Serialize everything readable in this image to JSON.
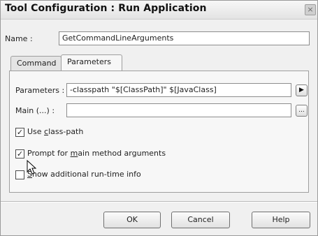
{
  "window": {
    "title": "Tool Configuration : Run Application",
    "close_glyph": "×"
  },
  "name_field": {
    "label": "Name :",
    "value": "GetCommandLineArguments"
  },
  "tabs": [
    {
      "label": "Command",
      "active": false
    },
    {
      "label": "Parameters",
      "active": true
    }
  ],
  "parameters_panel": {
    "parameters_label": "Parameters :",
    "parameters_value": "-classpath \"$[ClassPath]\" $[JavaClass]",
    "parameters_button_glyph": "▶",
    "main_label": "Main (...) :",
    "main_value": "",
    "main_button_glyph": "...",
    "checkboxes": [
      {
        "pre": "Use ",
        "mnemonic": "c",
        "post": "lass-path",
        "checked": true
      },
      {
        "pre": "Prompt for ",
        "mnemonic": "m",
        "post": "ain method arguments",
        "checked": true
      },
      {
        "pre": "",
        "mnemonic": "S",
        "post": "how additional run-time info",
        "checked": false
      }
    ],
    "check_glyph": "✓"
  },
  "buttons": {
    "ok": "OK",
    "cancel": "Cancel",
    "help": "Help"
  }
}
